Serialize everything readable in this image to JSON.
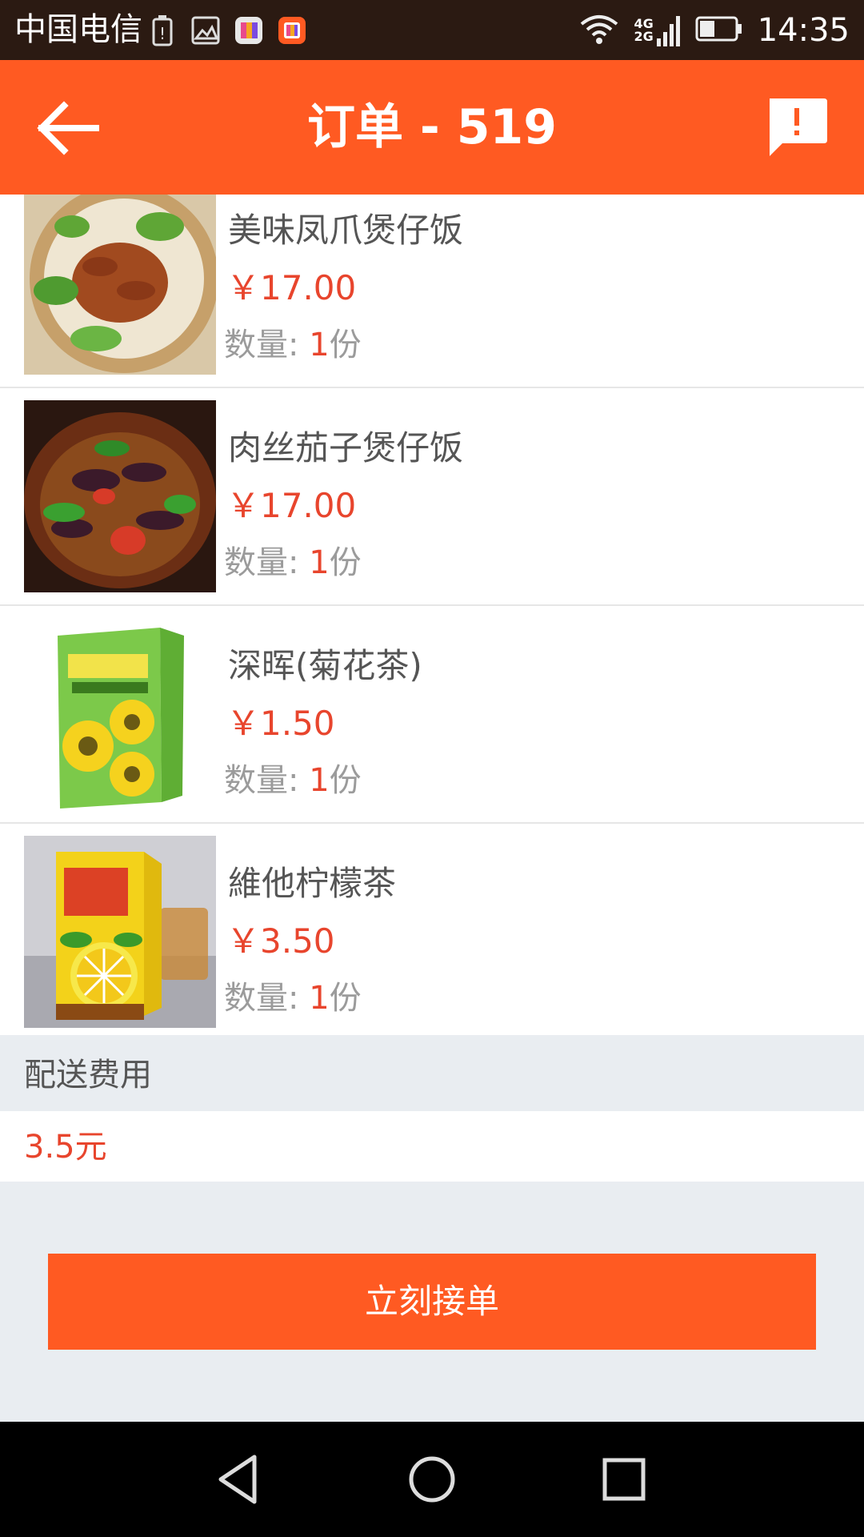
{
  "status_bar": {
    "carrier": "中国电信",
    "net_top": "4G",
    "net_bottom": "2G",
    "time": "14:35",
    "icons": [
      "battery-alert-icon",
      "image-icon",
      "app-icon-1",
      "app-icon-2",
      "wifi-icon",
      "signal-icon",
      "battery-icon"
    ]
  },
  "header": {
    "title": "订单 - 519",
    "back_icon": "back-arrow-icon",
    "feedback_icon": "feedback-icon"
  },
  "items": [
    {
      "name": "美味凤爪煲仔饭",
      "price": "￥17.00",
      "qty_label": "数量: ",
      "qty": "1",
      "qty_unit": "份"
    },
    {
      "name": "肉丝茄子煲仔饭",
      "price": "￥17.00",
      "qty_label": "数量: ",
      "qty": "1",
      "qty_unit": "份"
    },
    {
      "name": "深晖(菊花茶)",
      "price": "￥1.50",
      "qty_label": "数量: ",
      "qty": "1",
      "qty_unit": "份"
    },
    {
      "name": "維他柠檬茶",
      "price": "￥3.50",
      "qty_label": "数量: ",
      "qty": "1",
      "qty_unit": "份"
    }
  ],
  "delivery": {
    "label": "配送费用",
    "value": "3.5元"
  },
  "actions": {
    "accept_label": "立刻接单"
  },
  "colors": {
    "accent": "#ff5a22",
    "price": "#e8452d"
  }
}
